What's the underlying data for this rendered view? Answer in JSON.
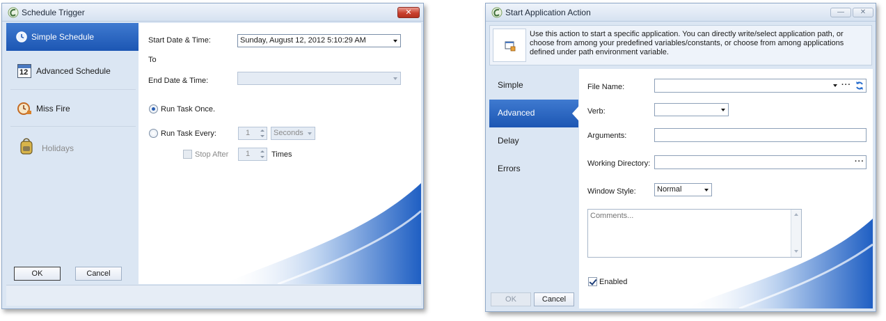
{
  "schedule_trigger": {
    "title": "Schedule Trigger",
    "close_label": "✕",
    "nav": [
      {
        "label": "Simple Schedule",
        "icon": "clock-icon",
        "selected": true,
        "enabled": true
      },
      {
        "label": "Advanced Schedule",
        "icon": "calendar-icon",
        "selected": false,
        "enabled": true
      },
      {
        "label": "Miss Fire",
        "icon": "alarm-clock-icon",
        "selected": false,
        "enabled": true
      },
      {
        "label": "Holidays",
        "icon": "backpack-icon",
        "selected": false,
        "enabled": false
      }
    ],
    "calendar_icon_text": "12",
    "start_label": "Start Date & Time:",
    "start_value": "Sunday, August 12, 2012 5:10:29 AM",
    "to_label": "To",
    "end_label": "End Date & Time:",
    "end_value": "",
    "run_once_label": "Run Task Once.",
    "run_once_selected": true,
    "run_every_label": "Run Task Every:",
    "run_every_value": "1",
    "interval_unit": "Seconds",
    "stop_after_label": "Stop After",
    "stop_after_value": "1",
    "times_label": "Times",
    "ok_label": "OK",
    "cancel_label": "Cancel"
  },
  "start_application_action": {
    "title": "Start Application Action",
    "minimize_label": "—",
    "close_label": "✕",
    "description": "Use this action to start a specific application. You can directly write/select application path, or choose from among your predefined variables/constants, or choose from among applications defined under path environment variable.",
    "nav": [
      {
        "label": "Simple",
        "selected": false
      },
      {
        "label": "Advanced",
        "selected": true
      },
      {
        "label": "Delay",
        "selected": false
      },
      {
        "label": "Errors",
        "selected": false
      }
    ],
    "file_name_label": "File Name:",
    "file_name_value": "",
    "browse_dots": "···",
    "verb_label": "Verb:",
    "verb_value": "",
    "arguments_label": "Arguments:",
    "arguments_value": "",
    "working_dir_label": "Working Directory:",
    "working_dir_value": "",
    "window_style_label": "Window Style:",
    "window_style_value": "Normal",
    "comments_placeholder": "Comments...",
    "enabled_label": "Enabled",
    "enabled_checked": true,
    "ok_label": "OK",
    "cancel_label": "Cancel"
  },
  "colors": {
    "accent": "#1c56b3",
    "frame": "#dbe6f3",
    "close": "#c9402f"
  }
}
